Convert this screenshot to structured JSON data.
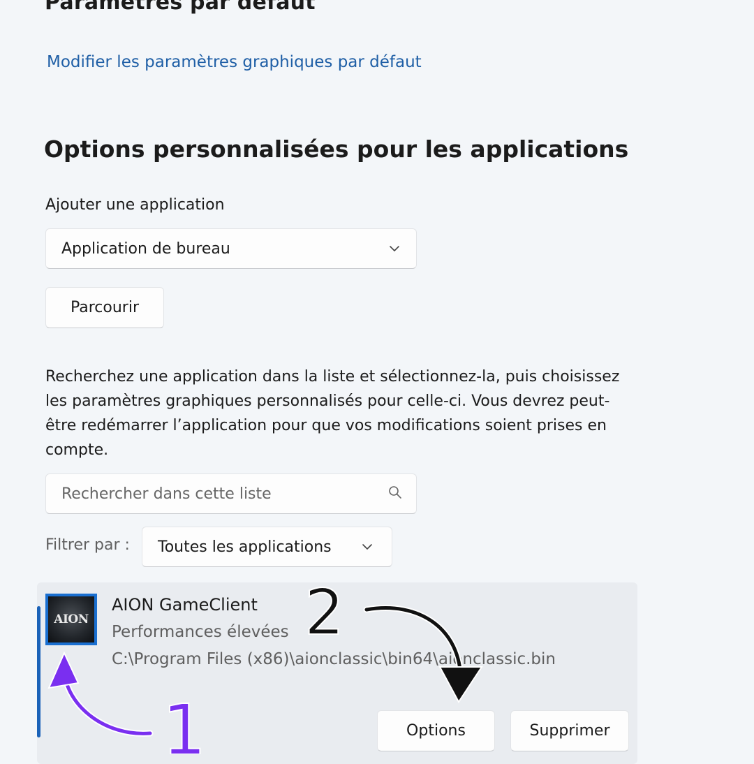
{
  "headings": {
    "default_settings": "Paramètres par défaut",
    "custom_options": "Options personnalisées pour les applications"
  },
  "links": {
    "modify_defaults": "Modifier les paramètres graphiques par défaut"
  },
  "add_app": {
    "label": "Ajouter une application",
    "type_selected": "Application de bureau",
    "browse_label": "Parcourir"
  },
  "description": "Recherchez une application dans la liste et sélectionnez-la, puis choisissez les paramètres graphiques personnalisés pour celle-ci. Vous devrez peut-être redémarrer l’application pour que vos modifications soient prises en compte.",
  "search": {
    "placeholder": "Rechercher dans cette liste",
    "icon": "search-icon"
  },
  "filter": {
    "label": "Filtrer par :",
    "selected": "Toutes les applications"
  },
  "app": {
    "icon_text": "AION",
    "name": "AION GameClient",
    "performance": "Performances élevées",
    "path": "C:\\Program Files (x86)\\aionclassic\\bin64\\aionclassic.bin",
    "options_label": "Options",
    "delete_label": "Supprimer"
  },
  "annotations": {
    "step1": "1",
    "step2": "2",
    "step1_color": "#7a2ff0",
    "step2_color": "#111111"
  },
  "colors": {
    "background": "#f3f6f9",
    "link": "#1f5fa6",
    "accent": "#1a62b8",
    "card": "#e9ecf0"
  }
}
